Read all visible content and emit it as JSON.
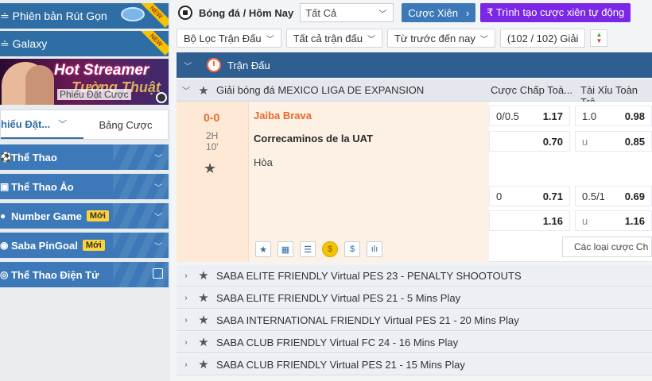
{
  "sidebar": {
    "promo1": {
      "label": "≐ Phiên bản Rút Gọn",
      "badge": "NEW"
    },
    "promo2": {
      "label": "≐ Galaxy",
      "badge": "NEW"
    },
    "banner": {
      "line1": "Hot Streamer",
      "line2": "Tường Thuật",
      "line3": "Phiếu Đặt Cược"
    },
    "slip_tab": "hiếu Đặt...",
    "bets_tab": "Bảng Cược",
    "items": [
      {
        "label": "Thể Thao",
        "new": ""
      },
      {
        "label": "Thể Thao Ảo",
        "new": ""
      },
      {
        "label": "Number Game",
        "new": "Mới"
      },
      {
        "label": "Saba PinGoal",
        "new": "Mới"
      },
      {
        "label": "Thể Thao Điện Tử",
        "new": ""
      }
    ]
  },
  "top": {
    "sport": "Bóng đá / Hôm Nay",
    "select": "Tất Cả",
    "parlay": "Cược Xiên",
    "builder": "₹ Trình tạo cược xiên tự động"
  },
  "filters": {
    "f1": "Bộ Lọc Trận Đấu",
    "f2": "Tất cả trận đấu",
    "f3": "Từ trước đến nay",
    "count": "(102 / 102) Giải"
  },
  "header": {
    "label": "Trận Đấu"
  },
  "league": {
    "name": "Giải bóng đá MEXICO LIGA DE EXPANSION",
    "col1": "Cược Chấp Toà...",
    "col2": "Tài Xỉu Toàn Trậ"
  },
  "match": {
    "score": "0-0",
    "period": "2H",
    "minute": "10'",
    "home": "Jaiba Brava",
    "away": "Correcaminos de la UAT",
    "draw": "Hòa",
    "hdp1": {
      "line": "0/0.5",
      "home": "1.17",
      "away": "0.70"
    },
    "ou1": {
      "line": "1.0",
      "over": "0.98",
      "under_label": "u",
      "under": "0.85"
    },
    "hdp2": {
      "line": "0",
      "home": "0.71",
      "away": "1.16"
    },
    "ou2": {
      "line": "0.5/1",
      "over": "0.69",
      "under_label": "u",
      "under": "1.16"
    },
    "more": "Các loại cược Ch"
  },
  "leagues": [
    "SABA ELITE FRIENDLY Virtual PES 23 - PENALTY SHOOTOUTS",
    "SABA ELITE FRIENDLY Virtual PES 21 - 5 Mins Play",
    "SABA INTERNATIONAL FRIENDLY Virtual PES 21 - 20 Mins Play",
    "SABA CLUB FRIENDLY Virtual FC 24 - 16 Mins Play",
    "SABA CLUB FRIENDLY Virtual PES 21 - 15 Mins Play"
  ],
  "colors": {
    "brand": "#3d79b8",
    "header": "#2f5f91",
    "accent": "#e8682a",
    "purple": "#7a28e6"
  }
}
